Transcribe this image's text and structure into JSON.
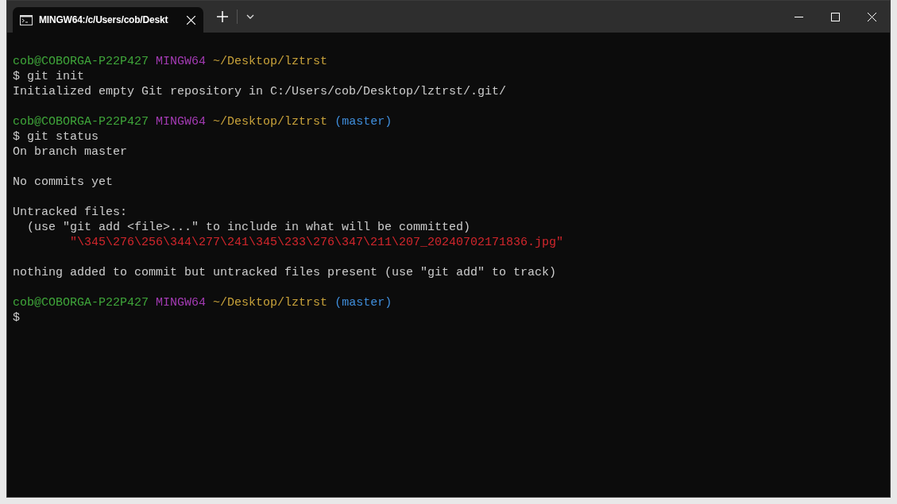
{
  "window": {
    "tabs": [
      {
        "title": "MINGW64:/c/Users/cob/Deskt",
        "selected": true
      }
    ]
  },
  "terminal": {
    "lines": [
      {
        "kind": "text",
        "segments": [
          {
            "text": "cob@COBORGA-P22P427",
            "color": "#3fa63a"
          },
          {
            "text": "MINGW64",
            "color": "#a43bb4"
          },
          {
            "text": "~/Desktop/lztrst",
            "color": "#c8a23a"
          }
        ]
      },
      {
        "kind": "text",
        "segments": [
          {
            "text": "$ git init",
            "color": "#cccccc"
          }
        ]
      },
      {
        "kind": "text",
        "segments": [
          {
            "text": "Initialized empty Git repository in C:/Users/cob/Desktop/lztrst/.git/",
            "color": "#cccccc"
          }
        ]
      },
      {
        "kind": "blank"
      },
      {
        "kind": "text",
        "segments": [
          {
            "text": "cob@COBORGA-P22P427",
            "color": "#3fa63a"
          },
          {
            "text": "MINGW64",
            "color": "#a43bb4"
          },
          {
            "text": "~/Desktop/lztrst",
            "color": "#c8a23a"
          },
          {
            "text": "(master)",
            "color": "#3f8edc"
          }
        ]
      },
      {
        "kind": "text",
        "segments": [
          {
            "text": "$ git status",
            "color": "#cccccc"
          }
        ]
      },
      {
        "kind": "text",
        "segments": [
          {
            "text": "On branch master",
            "color": "#cccccc"
          }
        ]
      },
      {
        "kind": "blank"
      },
      {
        "kind": "text",
        "segments": [
          {
            "text": "No commits yet",
            "color": "#cccccc"
          }
        ]
      },
      {
        "kind": "blank"
      },
      {
        "kind": "text",
        "segments": [
          {
            "text": "Untracked files:",
            "color": "#cccccc"
          }
        ]
      },
      {
        "kind": "text",
        "segments": [
          {
            "text": "  (use \"git add <file>...\" to include in what will be committed)",
            "color": "#cccccc"
          }
        ]
      },
      {
        "kind": "text",
        "segments": [
          {
            "text": "        \"\\345\\276\\256\\344\\277\\241\\345\\233\\276\\347\\211\\207_20240702171836.jpg\"",
            "color": "#d3262c"
          }
        ]
      },
      {
        "kind": "blank"
      },
      {
        "kind": "text",
        "segments": [
          {
            "text": "nothing added to commit but untracked files present (use \"git add\" to track)",
            "color": "#cccccc"
          }
        ]
      },
      {
        "kind": "blank"
      },
      {
        "kind": "text",
        "segments": [
          {
            "text": "cob@COBORGA-P22P427",
            "color": "#3fa63a"
          },
          {
            "text": "MINGW64",
            "color": "#a43bb4"
          },
          {
            "text": "~/Desktop/lztrst",
            "color": "#c8a23a"
          },
          {
            "text": "(master)",
            "color": "#3f8edc"
          }
        ]
      },
      {
        "kind": "text",
        "segments": [
          {
            "text": "$",
            "color": "#cccccc"
          }
        ]
      }
    ]
  }
}
